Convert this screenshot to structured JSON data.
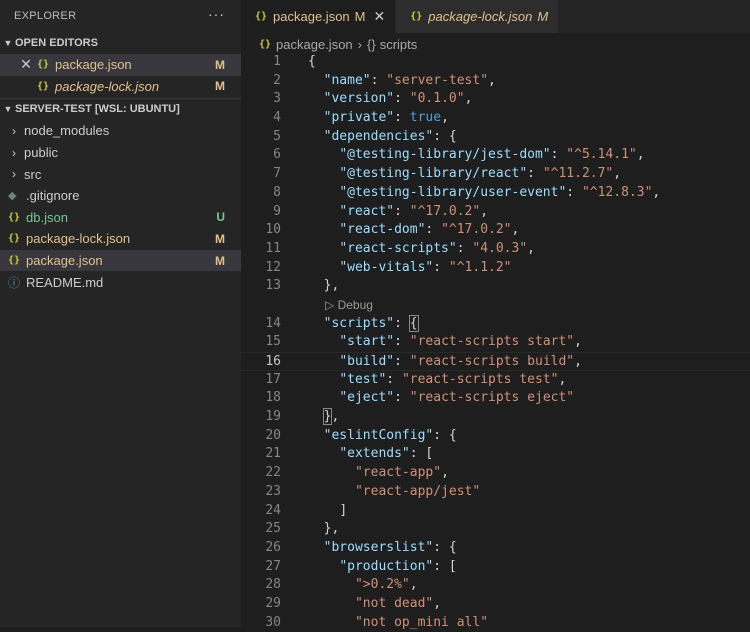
{
  "sidebar": {
    "title": "EXPLORER",
    "more": "···",
    "open_editors": {
      "label": "OPEN EDITORS",
      "items": [
        {
          "close": "✕",
          "name": "package.json",
          "status": "M"
        },
        {
          "name": "package-lock.json",
          "status": "M"
        }
      ]
    },
    "workspace": {
      "label": "SERVER-TEST [WSL: UBUNTU]",
      "folders": [
        {
          "name": "node_modules"
        },
        {
          "name": "public"
        },
        {
          "name": "src"
        }
      ],
      "files": [
        {
          "name": ".gitignore",
          "status": "",
          "icon": "gitignore-icon"
        },
        {
          "name": "db.json",
          "status": "U",
          "icon": "json-icon"
        },
        {
          "name": "package-lock.json",
          "status": "M",
          "icon": "json-icon"
        },
        {
          "name": "package.json",
          "status": "M",
          "icon": "json-icon"
        },
        {
          "name": "README.md",
          "status": "",
          "icon": "info-icon"
        }
      ]
    }
  },
  "tabs": [
    {
      "name": "package.json",
      "flag": "M",
      "active": true
    },
    {
      "name": "package-lock.json",
      "flag": "M",
      "active": false
    }
  ],
  "breadcrumb": {
    "file": "package.json",
    "symbol": "scripts"
  },
  "codelens": "Debug",
  "colors": {
    "modified": "#e2c08d",
    "untracked": "#73c991",
    "json": "#cbcb41",
    "key": "#9cdcfe",
    "string": "#ce9178",
    "boolean": "#569cd6"
  },
  "code_lines": [
    {
      "n": "1",
      "text": "{"
    },
    {
      "n": "2",
      "text": "  \"name\": \"server-test\","
    },
    {
      "n": "3",
      "text": "  \"version\": \"0.1.0\","
    },
    {
      "n": "4",
      "text": "  \"private\": true,"
    },
    {
      "n": "5",
      "text": "  \"dependencies\": {"
    },
    {
      "n": "6",
      "text": "    \"@testing-library/jest-dom\": \"^5.14.1\","
    },
    {
      "n": "7",
      "text": "    \"@testing-library/react\": \"^11.2.7\","
    },
    {
      "n": "8",
      "text": "    \"@testing-library/user-event\": \"^12.8.3\","
    },
    {
      "n": "9",
      "text": "    \"react\": \"^17.0.2\","
    },
    {
      "n": "10",
      "text": "    \"react-dom\": \"^17.0.2\","
    },
    {
      "n": "11",
      "text": "    \"react-scripts\": \"4.0.3\","
    },
    {
      "n": "12",
      "text": "    \"web-vitals\": \"^1.1.2\""
    },
    {
      "n": "13",
      "text": "  },"
    },
    {
      "n": "14",
      "text": "  \"scripts\": {"
    },
    {
      "n": "15",
      "text": "    \"start\": \"react-scripts start\","
    },
    {
      "n": "16",
      "text": "    \"build\": \"react-scripts build\","
    },
    {
      "n": "17",
      "text": "    \"test\": \"react-scripts test\","
    },
    {
      "n": "18",
      "text": "    \"eject\": \"react-scripts eject\""
    },
    {
      "n": "19",
      "text": "  },"
    },
    {
      "n": "20",
      "text": "  \"eslintConfig\": {"
    },
    {
      "n": "21",
      "text": "    \"extends\": ["
    },
    {
      "n": "22",
      "text": "      \"react-app\","
    },
    {
      "n": "23",
      "text": "      \"react-app/jest\""
    },
    {
      "n": "24",
      "text": "    ]"
    },
    {
      "n": "25",
      "text": "  },"
    },
    {
      "n": "26",
      "text": "  \"browserslist\": {"
    },
    {
      "n": "27",
      "text": "    \"production\": ["
    },
    {
      "n": "28",
      "text": "      \">0.2%\","
    },
    {
      "n": "29",
      "text": "      \"not dead\","
    },
    {
      "n": "30",
      "text": "      \"not op_mini all\""
    }
  ]
}
